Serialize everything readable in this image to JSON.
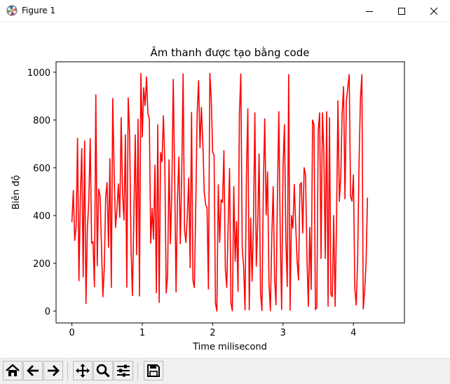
{
  "window": {
    "title": "Figure 1",
    "icons": {
      "app": "matplotlib-icon",
      "minimize": "minimize-icon",
      "maximize": "maximize-icon",
      "close": "close-icon"
    }
  },
  "toolbar": {
    "buttons": [
      {
        "name": "home-button",
        "icon": "home-icon"
      },
      {
        "name": "back-button",
        "icon": "arrow-left-icon"
      },
      {
        "name": "forward-button",
        "icon": "arrow-right-icon"
      },
      {
        "name": "pan-button",
        "icon": "move-icon"
      },
      {
        "name": "zoom-button",
        "icon": "zoom-icon"
      },
      {
        "name": "subplots-button",
        "icon": "sliders-icon"
      },
      {
        "name": "save-button",
        "icon": "save-icon"
      }
    ]
  },
  "chart_data": {
    "type": "line",
    "title": "Âm thanh được tạo bằng code",
    "xlabel": "Time milisecond",
    "ylabel": "Biên độ",
    "xlim": [
      -0.225,
      4.725
    ],
    "ylim": [
      -49.7,
      1043.7
    ],
    "x_ticks": [
      0,
      1,
      2,
      3,
      4
    ],
    "x_tick_labels": [
      "0",
      "1",
      "2",
      "3",
      "4"
    ],
    "y_ticks": [
      0,
      200,
      400,
      600,
      800,
      1000
    ],
    "y_tick_labels": [
      "0",
      "200",
      "400",
      "600",
      "800",
      "1000"
    ],
    "grid": false,
    "color": "#ff0000",
    "x_start": 0,
    "x_step": 0.02,
    "y": [
      372,
      505,
      296,
      352,
      724,
      127,
      478,
      680,
      143,
      712,
      32,
      346,
      458,
      722,
      284,
      290,
      102,
      905,
      190,
      511,
      483,
      274,
      60,
      180,
      478,
      538,
      267,
      638,
      99,
      890,
      581,
      350,
      424,
      532,
      392,
      810,
      491,
      381,
      738,
      100,
      893,
      740,
      267,
      65,
      391,
      738,
      236,
      803,
      63,
      995,
      729,
      935,
      860,
      980,
      827,
      805,
      284,
      430,
      302,
      611,
      77,
      780,
      36,
      663,
      625,
      818,
      624,
      75,
      152,
      633,
      283,
      504,
      970,
      565,
      80,
      467,
      645,
      282,
      566,
      993,
      342,
      287,
      400,
      557,
      182,
      832,
      129,
      98,
      443,
      828,
      965,
      684,
      853,
      709,
      498,
      447,
      431,
      92,
      995,
      887,
      664,
      654,
      32,
      0,
      529,
      288,
      466,
      455,
      672,
      178,
      99,
      358,
      597,
      33,
      1,
      522,
      208,
      375,
      83,
      825,
      993,
      266,
      184,
      5,
      570,
      847,
      5,
      389,
      125,
      372,
      830,
      188,
      362,
      658,
      75,
      2,
      515,
      805,
      403,
      583,
      118,
      1,
      308,
      521,
      140,
      26,
      478,
      835,
      325,
      6,
      603,
      780,
      300,
      103,
      990,
      4,
      400,
      347,
      530,
      358,
      210,
      130,
      530,
      537,
      327,
      600,
      570,
      220,
      20,
      350,
      90,
      800,
      780,
      6,
      15,
      755,
      830,
      220,
      830,
      670,
      220,
      835,
      20,
      810,
      70,
      60,
      400,
      20,
      370,
      880,
      460,
      560,
      830,
      940,
      470,
      880,
      935,
      990,
      480,
      460,
      570,
      95,
      25,
      215,
      620,
      890,
      990,
      9,
      85,
      205,
      475
    ],
    "y_note": "read approximately from the plotted curve"
  }
}
